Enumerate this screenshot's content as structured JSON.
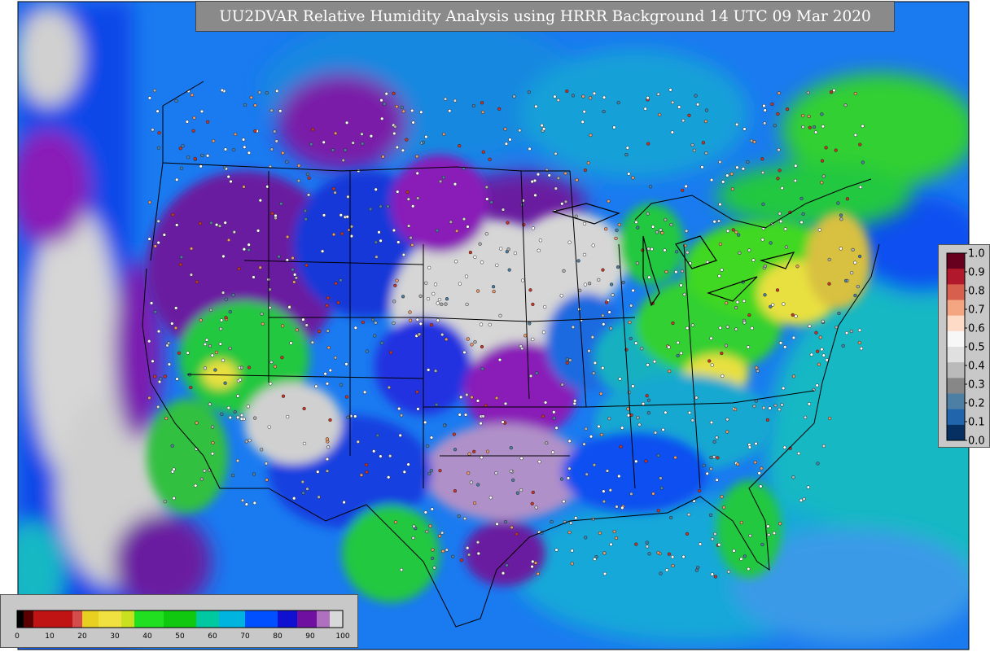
{
  "title": "UU2DVAR Relative Humidity Analysis using HRRR Background 14 UTC 09 Mar 2020",
  "obs_legend": {
    "ticks": [
      "1.0",
      "0.9",
      "0.8",
      "0.7",
      "0.6",
      "0.5",
      "0.4",
      "0.3",
      "0.2",
      "0.1",
      "0.0"
    ],
    "colors": [
      "#67001f",
      "#b2182b",
      "#d6604d",
      "#f4a582",
      "#fddbc7",
      "#f7f7f7",
      "#e0e0e0",
      "#bababa",
      "#878787",
      "#4d7fa5",
      "#2166ac",
      "#053061"
    ]
  },
  "field_legend": {
    "ticks": [
      "0",
      "10",
      "20",
      "30",
      "40",
      "50",
      "60",
      "70",
      "80",
      "90",
      "100"
    ],
    "bands": [
      {
        "from": 0,
        "to": 2,
        "color": "#000000"
      },
      {
        "from": 2,
        "to": 5,
        "color": "#5a0000"
      },
      {
        "from": 5,
        "to": 17,
        "color": "#c01414"
      },
      {
        "from": 17,
        "to": 20,
        "color": "#d44c4c"
      },
      {
        "from": 20,
        "to": 25,
        "color": "#e8d020"
      },
      {
        "from": 25,
        "to": 32,
        "color": "#f0e040"
      },
      {
        "from": 32,
        "to": 36,
        "color": "#c8e020"
      },
      {
        "from": 36,
        "to": 45,
        "color": "#20e020"
      },
      {
        "from": 45,
        "to": 55,
        "color": "#10c810"
      },
      {
        "from": 55,
        "to": 62,
        "color": "#00c8a0"
      },
      {
        "from": 62,
        "to": 70,
        "color": "#00b4e0"
      },
      {
        "from": 70,
        "to": 80,
        "color": "#0050ff"
      },
      {
        "from": 80,
        "to": 86,
        "color": "#1010d0"
      },
      {
        "from": 86,
        "to": 92,
        "color": "#7010a0"
      },
      {
        "from": 92,
        "to": 96,
        "color": "#b070c0"
      },
      {
        "from": 96,
        "to": 100,
        "color": "#d8d8d8"
      }
    ]
  },
  "colors": {
    "ocean_deep": "#0a50f0",
    "ocean_teal": "#16b8c4",
    "dry_grey": "#d6d6d6",
    "moist_purple": "#6a1aa0",
    "green": "#22d422",
    "yellow": "#e8e040",
    "border": "#000000"
  }
}
